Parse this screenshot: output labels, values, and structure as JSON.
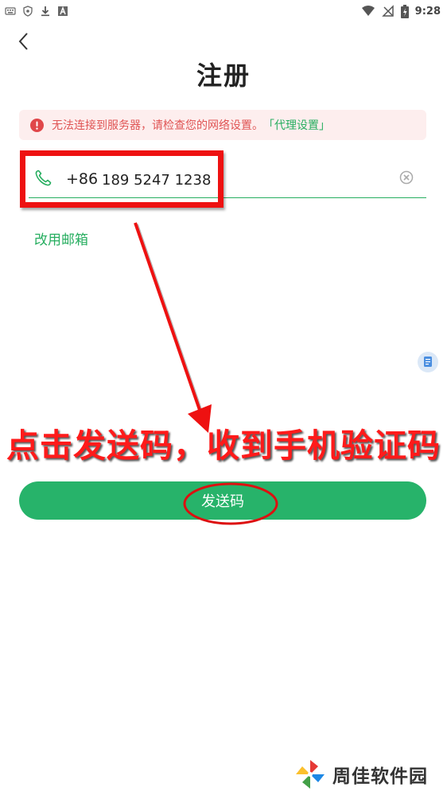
{
  "status_bar": {
    "time": "9:28",
    "icons": [
      "keyboard-icon",
      "shield-icon",
      "download-icon",
      "a-icon",
      "wifi-icon",
      "signal-off-icon",
      "battery-charging-icon"
    ]
  },
  "header": {
    "back_icon": "chevron-left-icon",
    "title": "注册"
  },
  "banner": {
    "icon": "alert-circle-icon",
    "message": "无法连接到服务器，请检查您的网络设置。",
    "link": "「代理设置」",
    "colors": {
      "text": "#e05454",
      "link": "#27ae60",
      "background": "#fdeeee"
    }
  },
  "phone_field": {
    "icon": "phone-icon",
    "country_code": "+86",
    "value": "189 5247 1238",
    "clear_icon": "clear-circle-icon"
  },
  "use_email_link": "改用邮箱",
  "float_button_icon": "document-icon",
  "annotation": {
    "text": "点击发送码，收到手机验证码",
    "color": "#ff1a1a"
  },
  "send_button": {
    "label": "发送码",
    "color": "#27b36a"
  },
  "watermark": {
    "text": "周佳软件园"
  }
}
